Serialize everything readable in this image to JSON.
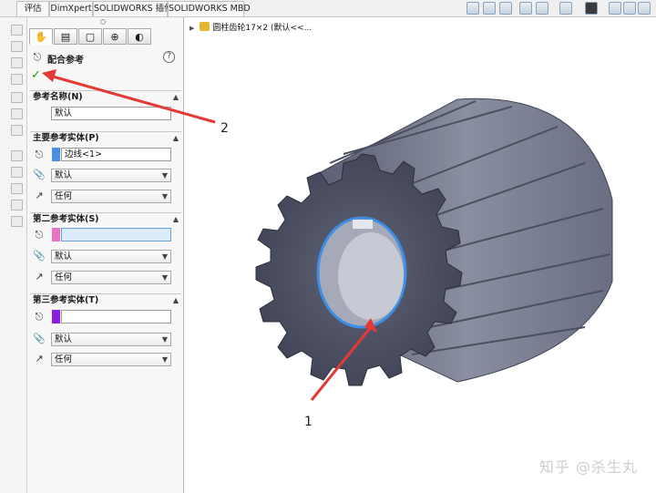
{
  "tabs": [
    "评估",
    "DimXpert",
    "SOLIDWORKS 插件",
    "SOLIDWORKS MBD"
  ],
  "toolbar_icons": [
    "zoom-fit-icon",
    "zoom-area-icon",
    "previous-view-icon",
    "section-view-icon",
    "view-orientation-icon",
    "display-style-icon",
    "hide-show-icon",
    "appearance-icon",
    "scene-icon",
    "view-settings-icon"
  ],
  "property_manager": {
    "title": "配合参考",
    "ok_symbol": "✓",
    "help_symbol": "?",
    "sections": {
      "ref_name": {
        "label": "参考名称(N)",
        "value": "默认"
      },
      "primary": {
        "label": "主要参考实体(P)",
        "entity": "边线<1>",
        "color": "#4a90e2",
        "mate_type": "默认",
        "alignment": "任何"
      },
      "secondary": {
        "label": "第二参考实体(S)",
        "entity": "",
        "color": "#e872c4",
        "mate_type": "默认",
        "alignment": "任何"
      },
      "tertiary": {
        "label": "第三参考实体(T)",
        "entity": "",
        "color": "#8a1fe0",
        "mate_type": "默认",
        "alignment": "任何"
      }
    }
  },
  "tree": {
    "item": "圆柱齿轮17×2 (默认<<..."
  },
  "annotations": {
    "label1": "1",
    "label2": "2"
  },
  "watermark": "知乎 @杀生丸",
  "colors": {
    "arrow": "#e53935",
    "gear": "#6f7387",
    "hole_edge": "#3d8ee6"
  }
}
